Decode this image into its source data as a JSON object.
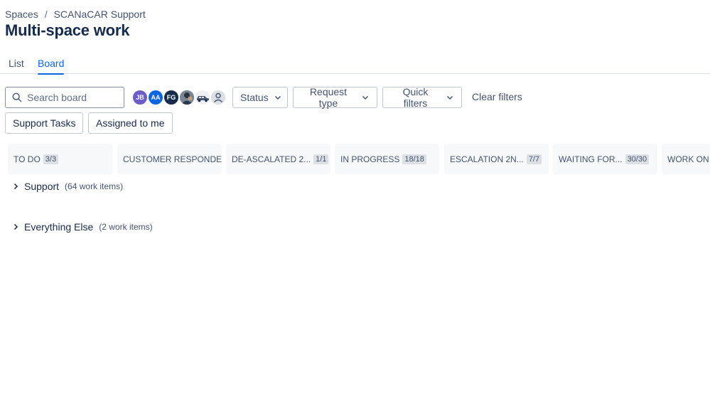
{
  "breadcrumb": {
    "items": [
      "Spaces",
      "SCANaCAR Support"
    ],
    "separator": "/"
  },
  "page_title": "Multi-space work",
  "tabs": [
    {
      "label": "List",
      "active": false
    },
    {
      "label": "Board",
      "active": true
    }
  ],
  "toolbar": {
    "search_placeholder": "Search board",
    "avatars": [
      {
        "initials": "JB",
        "color": "#6e5dc6"
      },
      {
        "initials": "AA",
        "color": "#0c66e4"
      },
      {
        "initials": "FG",
        "color": "#172b4d"
      },
      {
        "initials": "",
        "kind": "photo",
        "icon": "avatar-photo-icon"
      },
      {
        "initials": "",
        "kind": "car",
        "icon": "car-icon"
      },
      {
        "initials": "",
        "kind": "unassigned",
        "icon": "person-icon"
      }
    ],
    "filters": [
      "Status",
      "Request type",
      "Quick filters"
    ],
    "clear_filters": "Clear filters",
    "quick_buttons": [
      "Support Tasks",
      "Assigned to me"
    ]
  },
  "columns": [
    {
      "name": "TO DO",
      "count": "3/3"
    },
    {
      "name": "CUSTOMER RESPONDED",
      "count": ""
    },
    {
      "name": "DE-ASCALATED 2...",
      "count": "1/1"
    },
    {
      "name": "IN PROGRESS",
      "count": "18/18"
    },
    {
      "name": "ESCALATION 2N...",
      "count": "7/7"
    },
    {
      "name": "WAITING FOR...",
      "count": "30/30"
    },
    {
      "name": "WORK ON L",
      "count": ""
    }
  ],
  "swimlanes": [
    {
      "name": "Support",
      "count": "(64 work items)"
    },
    {
      "name": "Everything Else",
      "count": "(2 work items)"
    }
  ],
  "colors": {
    "accent": "#0c66e4",
    "text": "#172b4d",
    "subtle_text": "#44546f",
    "column_bg": "#f7f8f9"
  }
}
